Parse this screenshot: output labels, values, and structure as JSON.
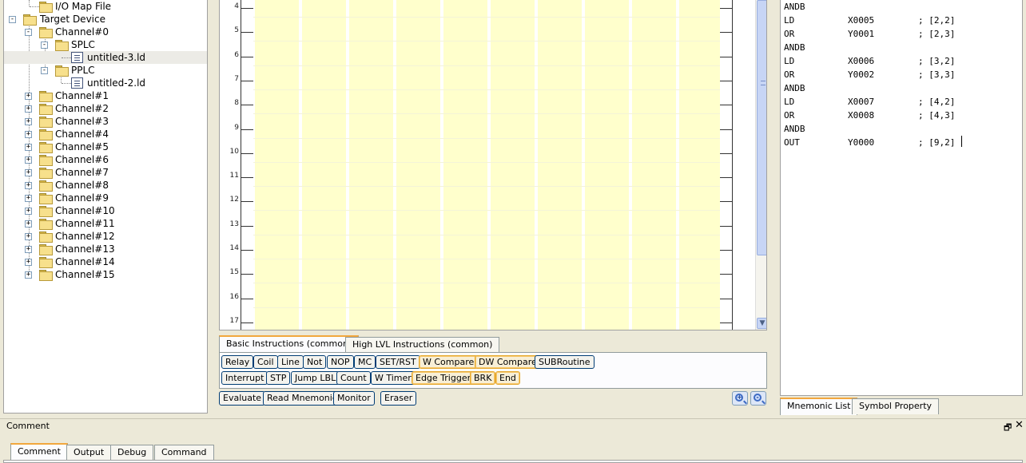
{
  "tree": {
    "items": [
      {
        "label": "I/O Map File",
        "icon": "folder-icon",
        "expander": ""
      },
      {
        "label": "Target Device",
        "icon": "folder-icon",
        "expander": "-"
      },
      {
        "label": "Channel#0",
        "icon": "folder-icon",
        "expander": "-"
      },
      {
        "label": "SPLC",
        "icon": "folder-icon",
        "expander": "-"
      },
      {
        "label": "untitled-3.ld",
        "icon": "ladder-file-icon",
        "expander": ""
      },
      {
        "label": "PPLC",
        "icon": "folder-icon",
        "expander": "-"
      },
      {
        "label": "untitled-2.ld",
        "icon": "ladder-file-icon",
        "expander": ""
      },
      {
        "label": "Channel#1",
        "icon": "folder-icon",
        "expander": "+"
      },
      {
        "label": "Channel#2",
        "icon": "folder-icon",
        "expander": "+"
      },
      {
        "label": "Channel#3",
        "icon": "folder-icon",
        "expander": "+"
      },
      {
        "label": "Channel#4",
        "icon": "folder-icon",
        "expander": "+"
      },
      {
        "label": "Channel#5",
        "icon": "folder-icon",
        "expander": "+"
      },
      {
        "label": "Channel#6",
        "icon": "folder-icon",
        "expander": "+"
      },
      {
        "label": "Channel#7",
        "icon": "folder-icon",
        "expander": "+"
      },
      {
        "label": "Channel#8",
        "icon": "folder-icon",
        "expander": "+"
      },
      {
        "label": "Channel#9",
        "icon": "folder-icon",
        "expander": "+"
      },
      {
        "label": "Channel#10",
        "icon": "folder-icon",
        "expander": "+"
      },
      {
        "label": "Channel#11",
        "icon": "folder-icon",
        "expander": "+"
      },
      {
        "label": "Channel#12",
        "icon": "folder-icon",
        "expander": "+"
      },
      {
        "label": "Channel#13",
        "icon": "folder-icon",
        "expander": "+"
      },
      {
        "label": "Channel#14",
        "icon": "folder-icon",
        "expander": "+"
      },
      {
        "label": "Channel#15",
        "icon": "folder-icon",
        "expander": "+"
      }
    ],
    "selected": "untitled-3.ld"
  },
  "ladder": {
    "rung_numbers": [
      "4",
      "5",
      "6",
      "7",
      "8",
      "9",
      "10",
      "11",
      "12",
      "13",
      "14",
      "15",
      "16",
      "17"
    ],
    "cell_color": "#ffffcc"
  },
  "instruction_tabs": [
    {
      "label": "Basic Instructions (common)",
      "active": true
    },
    {
      "label": "High LVL Instructions (common)",
      "active": false
    }
  ],
  "instruction_buttons": {
    "row1": [
      "Relay",
      "Coil",
      "Line",
      "Not",
      "NOP",
      "MC",
      "SET/RST",
      "W Compare",
      "DW Compare",
      "SUBRoutine"
    ],
    "row2": [
      "Interrupt",
      "STP",
      "Jump LBL",
      "Count",
      "W Timer",
      "Edge Trigger",
      "BRK",
      "End"
    ]
  },
  "bottom_buttons": {
    "evaluate": "Evaluate",
    "read_mnemonic": "Read Mnemonic",
    "monitor": "Monitor",
    "eraser": "Eraser"
  },
  "mnemonic": {
    "lines": [
      {
        "op": "ANDB",
        "arg": "",
        "comment": ""
      },
      {
        "op": "LD",
        "arg": "X0005",
        "comment": "; [2,2]"
      },
      {
        "op": "OR",
        "arg": "Y0001",
        "comment": "; [2,3]"
      },
      {
        "op": "ANDB",
        "arg": "",
        "comment": ""
      },
      {
        "op": "LD",
        "arg": "X0006",
        "comment": "; [3,2]"
      },
      {
        "op": "OR",
        "arg": "Y0002",
        "comment": "; [3,3]"
      },
      {
        "op": "ANDB",
        "arg": "",
        "comment": ""
      },
      {
        "op": "LD",
        "arg": "X0007",
        "comment": "; [4,2]"
      },
      {
        "op": "OR",
        "arg": "X0008",
        "comment": "; [4,3]"
      },
      {
        "op": "ANDB",
        "arg": "",
        "comment": ""
      },
      {
        "op": "OUT",
        "arg": "Y0000",
        "comment": "; [9,2]"
      }
    ],
    "tabs": [
      "Mnemonic List",
      "Symbol Property"
    ]
  },
  "comment_pane": {
    "title": "Comment",
    "pin": "🗗",
    "close": "✕",
    "tabs": [
      "Comment",
      "Output",
      "Debug",
      "Command"
    ]
  }
}
